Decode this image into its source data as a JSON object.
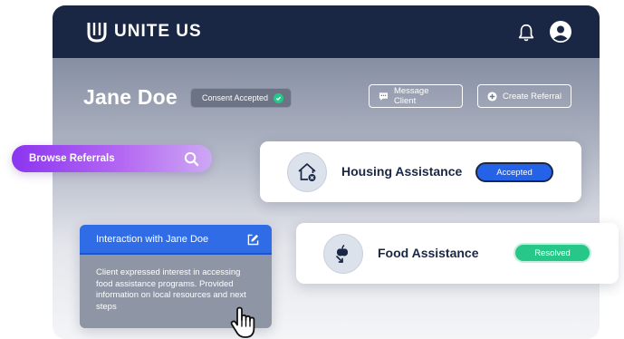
{
  "app": {
    "logo_text": "UNITE US"
  },
  "client": {
    "name": "Jane Doe",
    "consent_label": "Consent Accepted"
  },
  "actions": {
    "message_label": "Message Client",
    "create_referral_label": "Create Referral"
  },
  "browse": {
    "label": "Browse Referrals"
  },
  "services": [
    {
      "title": "Housing Assistance",
      "status": "Accepted",
      "icon": "house-icon",
      "status_color": "#2463e8"
    },
    {
      "title": "Food Assistance",
      "status": "Resolved",
      "icon": "apple-icon",
      "status_color": "#27c78a"
    }
  ],
  "interaction": {
    "title": "Interaction with Jane Doe",
    "body": "Client expressed interest in accessing food assistance programs. Provided information on local resources and next steps"
  },
  "colors": {
    "navy": "#1a2744",
    "accent_blue": "#2f6ce6",
    "purple": "#8b35f0",
    "green": "#27c78a"
  }
}
